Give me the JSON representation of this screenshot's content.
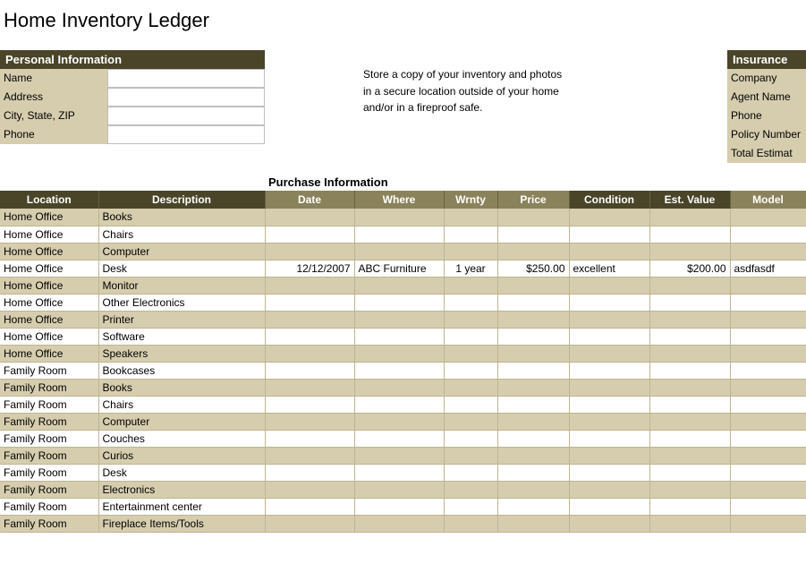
{
  "title": "Home Inventory Ledger",
  "personal": {
    "header": "Personal Information",
    "fields": [
      {
        "label": "Name",
        "value": ""
      },
      {
        "label": "Address",
        "value": ""
      },
      {
        "label": "City, State, ZIP",
        "value": ""
      },
      {
        "label": "Phone",
        "value": ""
      }
    ]
  },
  "instructions": {
    "line1": "Store a copy of your inventory and photos",
    "line2": "in a secure location outside of your home",
    "line3": "and/or in a fireproof safe."
  },
  "insurance": {
    "header": "Insurance",
    "fields": [
      "Company",
      "Agent Name",
      "Phone",
      "Policy Number",
      "Total Estimat"
    ]
  },
  "purchase_section_label": "Purchase Information",
  "columns": {
    "location": "Location",
    "description": "Description",
    "date": "Date",
    "where": "Where",
    "wrnty": "Wrnty",
    "price": "Price",
    "condition": "Condition",
    "est_value": "Est. Value",
    "model": "Model"
  },
  "rows": [
    {
      "location": "Home Office",
      "description": "Books"
    },
    {
      "location": "Home Office",
      "description": "Chairs"
    },
    {
      "location": "Home Office",
      "description": "Computer"
    },
    {
      "location": "Home Office",
      "description": "Desk",
      "date": "12/12/2007",
      "where": "ABC Furniture",
      "wrnty": "1 year",
      "price": "$250.00",
      "condition": "excellent",
      "est_value": "$200.00",
      "model": "asdfasdf"
    },
    {
      "location": "Home Office",
      "description": "Monitor"
    },
    {
      "location": "Home Office",
      "description": "Other Electronics"
    },
    {
      "location": "Home Office",
      "description": "Printer"
    },
    {
      "location": "Home Office",
      "description": "Software"
    },
    {
      "location": "Home Office",
      "description": "Speakers"
    },
    {
      "location": "Family Room",
      "description": "Bookcases"
    },
    {
      "location": "Family Room",
      "description": "Books"
    },
    {
      "location": "Family Room",
      "description": "Chairs"
    },
    {
      "location": "Family Room",
      "description": "Computer"
    },
    {
      "location": "Family Room",
      "description": "Couches"
    },
    {
      "location": "Family Room",
      "description": "Curios"
    },
    {
      "location": "Family Room",
      "description": "Desk"
    },
    {
      "location": "Family Room",
      "description": "Electronics"
    },
    {
      "location": "Family Room",
      "description": "Entertainment center"
    },
    {
      "location": "Family Room",
      "description": "Fireplace Items/Tools"
    }
  ]
}
